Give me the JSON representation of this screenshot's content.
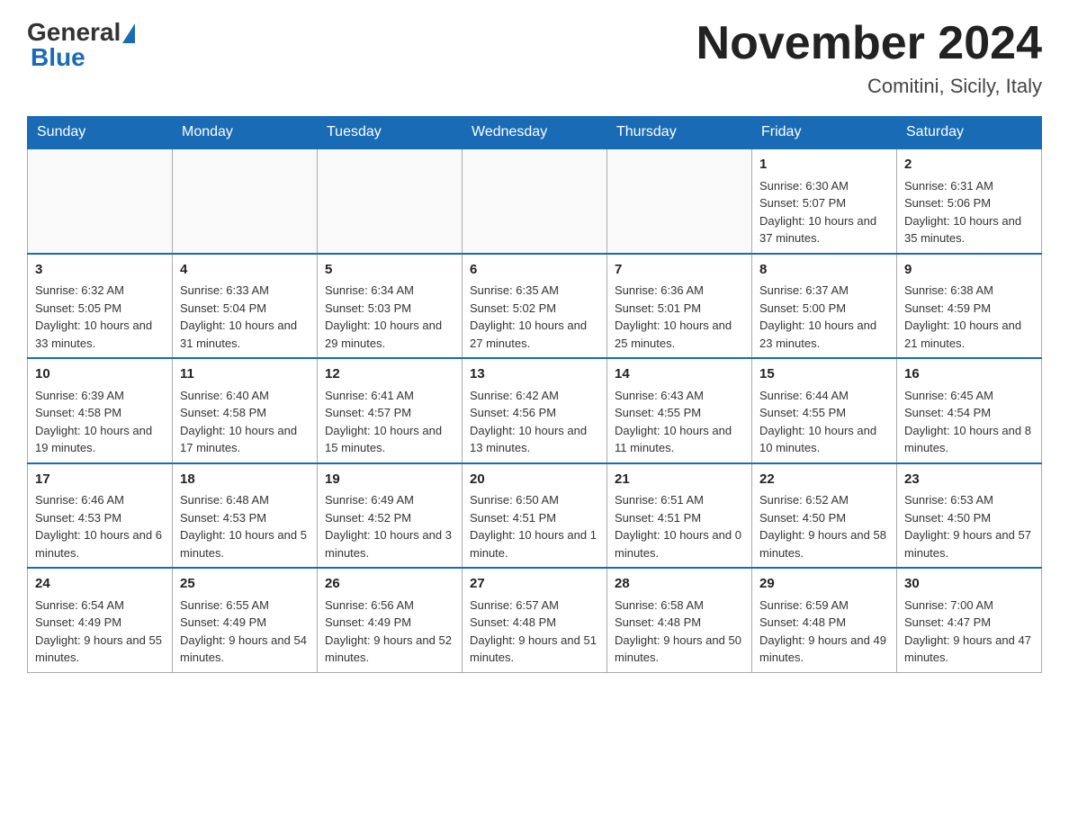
{
  "logo": {
    "general": "General",
    "blue": "Blue"
  },
  "header": {
    "month_year": "November 2024",
    "location": "Comitini, Sicily, Italy"
  },
  "weekdays": [
    "Sunday",
    "Monday",
    "Tuesday",
    "Wednesday",
    "Thursday",
    "Friday",
    "Saturday"
  ],
  "weeks": [
    [
      {
        "day": "",
        "info": ""
      },
      {
        "day": "",
        "info": ""
      },
      {
        "day": "",
        "info": ""
      },
      {
        "day": "",
        "info": ""
      },
      {
        "day": "",
        "info": ""
      },
      {
        "day": "1",
        "info": "Sunrise: 6:30 AM\nSunset: 5:07 PM\nDaylight: 10 hours and 37 minutes."
      },
      {
        "day": "2",
        "info": "Sunrise: 6:31 AM\nSunset: 5:06 PM\nDaylight: 10 hours and 35 minutes."
      }
    ],
    [
      {
        "day": "3",
        "info": "Sunrise: 6:32 AM\nSunset: 5:05 PM\nDaylight: 10 hours and 33 minutes."
      },
      {
        "day": "4",
        "info": "Sunrise: 6:33 AM\nSunset: 5:04 PM\nDaylight: 10 hours and 31 minutes."
      },
      {
        "day": "5",
        "info": "Sunrise: 6:34 AM\nSunset: 5:03 PM\nDaylight: 10 hours and 29 minutes."
      },
      {
        "day": "6",
        "info": "Sunrise: 6:35 AM\nSunset: 5:02 PM\nDaylight: 10 hours and 27 minutes."
      },
      {
        "day": "7",
        "info": "Sunrise: 6:36 AM\nSunset: 5:01 PM\nDaylight: 10 hours and 25 minutes."
      },
      {
        "day": "8",
        "info": "Sunrise: 6:37 AM\nSunset: 5:00 PM\nDaylight: 10 hours and 23 minutes."
      },
      {
        "day": "9",
        "info": "Sunrise: 6:38 AM\nSunset: 4:59 PM\nDaylight: 10 hours and 21 minutes."
      }
    ],
    [
      {
        "day": "10",
        "info": "Sunrise: 6:39 AM\nSunset: 4:58 PM\nDaylight: 10 hours and 19 minutes."
      },
      {
        "day": "11",
        "info": "Sunrise: 6:40 AM\nSunset: 4:58 PM\nDaylight: 10 hours and 17 minutes."
      },
      {
        "day": "12",
        "info": "Sunrise: 6:41 AM\nSunset: 4:57 PM\nDaylight: 10 hours and 15 minutes."
      },
      {
        "day": "13",
        "info": "Sunrise: 6:42 AM\nSunset: 4:56 PM\nDaylight: 10 hours and 13 minutes."
      },
      {
        "day": "14",
        "info": "Sunrise: 6:43 AM\nSunset: 4:55 PM\nDaylight: 10 hours and 11 minutes."
      },
      {
        "day": "15",
        "info": "Sunrise: 6:44 AM\nSunset: 4:55 PM\nDaylight: 10 hours and 10 minutes."
      },
      {
        "day": "16",
        "info": "Sunrise: 6:45 AM\nSunset: 4:54 PM\nDaylight: 10 hours and 8 minutes."
      }
    ],
    [
      {
        "day": "17",
        "info": "Sunrise: 6:46 AM\nSunset: 4:53 PM\nDaylight: 10 hours and 6 minutes."
      },
      {
        "day": "18",
        "info": "Sunrise: 6:48 AM\nSunset: 4:53 PM\nDaylight: 10 hours and 5 minutes."
      },
      {
        "day": "19",
        "info": "Sunrise: 6:49 AM\nSunset: 4:52 PM\nDaylight: 10 hours and 3 minutes."
      },
      {
        "day": "20",
        "info": "Sunrise: 6:50 AM\nSunset: 4:51 PM\nDaylight: 10 hours and 1 minute."
      },
      {
        "day": "21",
        "info": "Sunrise: 6:51 AM\nSunset: 4:51 PM\nDaylight: 10 hours and 0 minutes."
      },
      {
        "day": "22",
        "info": "Sunrise: 6:52 AM\nSunset: 4:50 PM\nDaylight: 9 hours and 58 minutes."
      },
      {
        "day": "23",
        "info": "Sunrise: 6:53 AM\nSunset: 4:50 PM\nDaylight: 9 hours and 57 minutes."
      }
    ],
    [
      {
        "day": "24",
        "info": "Sunrise: 6:54 AM\nSunset: 4:49 PM\nDaylight: 9 hours and 55 minutes."
      },
      {
        "day": "25",
        "info": "Sunrise: 6:55 AM\nSunset: 4:49 PM\nDaylight: 9 hours and 54 minutes."
      },
      {
        "day": "26",
        "info": "Sunrise: 6:56 AM\nSunset: 4:49 PM\nDaylight: 9 hours and 52 minutes."
      },
      {
        "day": "27",
        "info": "Sunrise: 6:57 AM\nSunset: 4:48 PM\nDaylight: 9 hours and 51 minutes."
      },
      {
        "day": "28",
        "info": "Sunrise: 6:58 AM\nSunset: 4:48 PM\nDaylight: 9 hours and 50 minutes."
      },
      {
        "day": "29",
        "info": "Sunrise: 6:59 AM\nSunset: 4:48 PM\nDaylight: 9 hours and 49 minutes."
      },
      {
        "day": "30",
        "info": "Sunrise: 7:00 AM\nSunset: 4:47 PM\nDaylight: 9 hours and 47 minutes."
      }
    ]
  ]
}
